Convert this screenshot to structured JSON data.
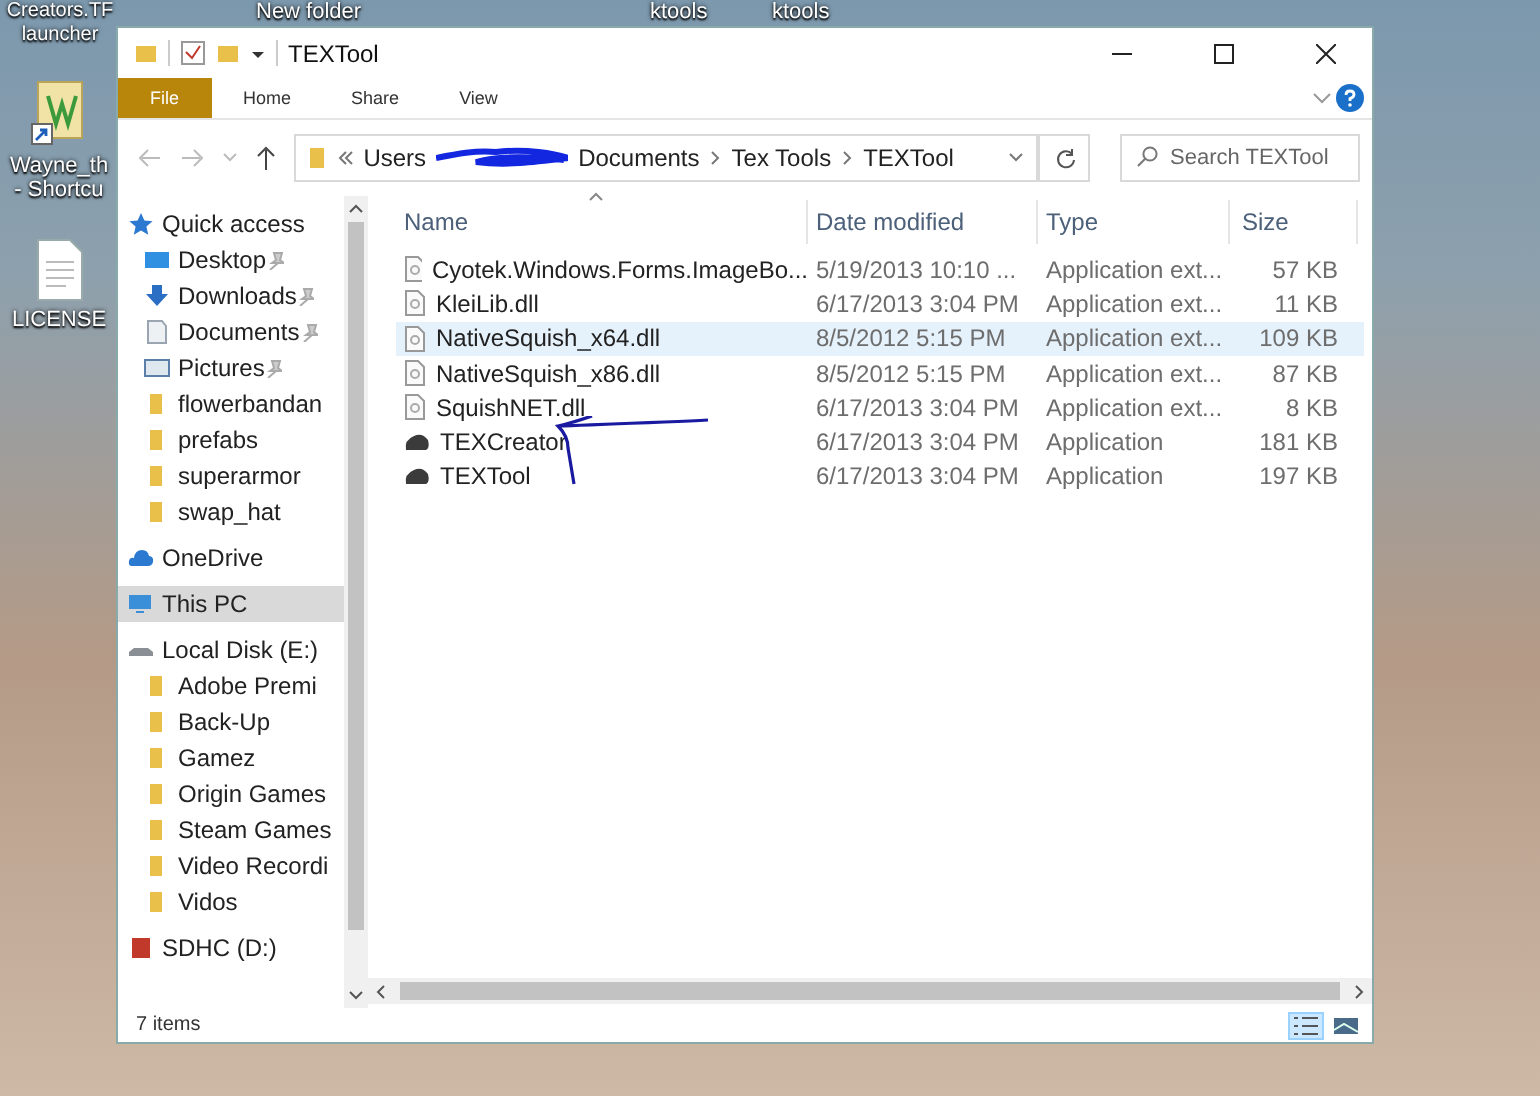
{
  "desktop": {
    "top_labels": [
      "Creators.TF launcher",
      "New folder",
      "ktools",
      "ktools"
    ],
    "left_icons": [
      {
        "label": "Wayne_th - Shortcu",
        "kind": "shortcut"
      },
      {
        "label": "LICENSE",
        "kind": "file"
      }
    ]
  },
  "window": {
    "title": "TEXTool"
  },
  "ribbon": {
    "tabs": [
      {
        "label": "File",
        "kind": "menu"
      },
      {
        "label": "Home",
        "kind": "tab"
      },
      {
        "label": "Share",
        "kind": "tab"
      },
      {
        "label": "View",
        "kind": "tab"
      }
    ]
  },
  "address": {
    "crumbs": [
      "Users",
      "Documents",
      "Tex Tools",
      "TEXTool"
    ]
  },
  "search": {
    "placeholder": "Search TEXTool"
  },
  "nav": [
    {
      "label": "Quick access",
      "kind": "star",
      "selected": false,
      "children": [
        {
          "label": "Desktop",
          "kind": "desktop",
          "pinned": true,
          "selected": false
        },
        {
          "label": "Downloads",
          "kind": "download",
          "pinned": true,
          "selected": false
        },
        {
          "label": "Documents",
          "kind": "document",
          "pinned": true,
          "selected": false
        },
        {
          "label": "Pictures",
          "kind": "picture",
          "pinned": true,
          "selected": false
        },
        {
          "label": "flowerbandan",
          "kind": "folder",
          "pinned": false,
          "selected": false
        },
        {
          "label": "prefabs",
          "kind": "folder",
          "pinned": false,
          "selected": false
        },
        {
          "label": "superarmor",
          "kind": "folder",
          "pinned": false,
          "selected": false
        },
        {
          "label": "swap_hat",
          "kind": "folder",
          "pinned": false,
          "selected": false
        }
      ]
    },
    {
      "label": "OneDrive",
      "kind": "cloud",
      "selected": false
    },
    {
      "label": "This PC",
      "kind": "pc",
      "selected": true
    },
    {
      "label": "Local Disk (E:)",
      "kind": "disk",
      "selected": false,
      "children": [
        {
          "label": "Adobe Premi",
          "kind": "folder",
          "pinned": false,
          "selected": false
        },
        {
          "label": "Back-Up",
          "kind": "folder",
          "pinned": false,
          "selected": false
        },
        {
          "label": "Gamez",
          "kind": "folder",
          "pinned": false,
          "selected": false
        },
        {
          "label": "Origin Games",
          "kind": "folder",
          "pinned": false,
          "selected": false
        },
        {
          "label": "Steam Games",
          "kind": "folder",
          "pinned": false,
          "selected": false
        },
        {
          "label": "Video Recordi",
          "kind": "folder",
          "pinned": false,
          "selected": false
        },
        {
          "label": "Vidos",
          "kind": "folder",
          "pinned": false,
          "selected": false
        }
      ]
    },
    {
      "label": "SDHC (D:)",
      "kind": "sd",
      "selected": false
    }
  ],
  "table": {
    "columns": [
      "Name",
      "Date modified",
      "Type",
      "Size"
    ],
    "rows": [
      {
        "name": "Cyotek.Windows.Forms.ImageBo...",
        "date": "5/19/2013 10:10 ...",
        "type": "Application ext...",
        "size": "57 KB",
        "kind": "dll",
        "selected": false
      },
      {
        "name": "KleiLib.dll",
        "date": "6/17/2013 3:04 PM",
        "type": "Application ext...",
        "size": "11 KB",
        "kind": "dll",
        "selected": false
      },
      {
        "name": "NativeSquish_x64.dll",
        "date": "8/5/2012 5:15 PM",
        "type": "Application ext...",
        "size": "109 KB",
        "kind": "dll",
        "selected": true
      },
      {
        "name": "NativeSquish_x86.dll",
        "date": "8/5/2012 5:15 PM",
        "type": "Application ext...",
        "size": "87 KB",
        "kind": "dll",
        "selected": false
      },
      {
        "name": "SquishNET.dll",
        "date": "6/17/2013 3:04 PM",
        "type": "Application ext...",
        "size": "8 KB",
        "kind": "dll",
        "selected": false
      },
      {
        "name": "TEXCreator",
        "date": "6/17/2013 3:04 PM",
        "type": "Application",
        "size": "181 KB",
        "kind": "app",
        "selected": false
      },
      {
        "name": "TEXTool",
        "date": "6/17/2013 3:04 PM",
        "type": "Application",
        "size": "197 KB",
        "kind": "app",
        "selected": false
      }
    ]
  },
  "status_bar": {
    "text": "7 items",
    "views": [
      {
        "kind": "details",
        "selected": true
      },
      {
        "kind": "tiles",
        "selected": false
      }
    ]
  }
}
